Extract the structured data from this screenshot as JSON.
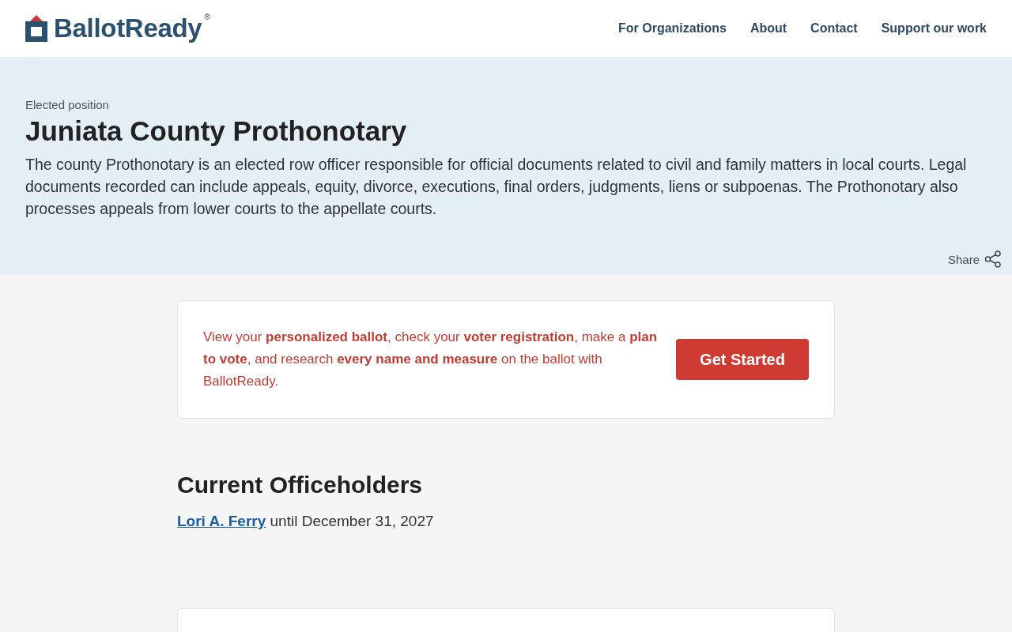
{
  "header": {
    "logo": {
      "name": "BallotReady",
      "mark": "®"
    },
    "nav": [
      "For Organizations",
      "About",
      "Contact",
      "Support our work"
    ]
  },
  "hero": {
    "eyebrow": "Elected position",
    "title": "Juniata County Prothonotary",
    "description": "The county Prothonotary is an elected row officer responsible for official documents related to civil and family matters in local courts. Legal documents recorded can include appeals, equity, divorce, executions, final orders, judgments, liens or subpoenas. The Prothonotary also processes appeals from lower courts to the appellate courts.",
    "share": "Share"
  },
  "cta_card": {
    "text": "View your **personalized ballot**, check your **voter registration**, make a **plan to vote**, and research **every name and measure** on the ballot with BallotReady.",
    "button": "Get Started"
  },
  "officeholders": {
    "heading": "Current Officeholders",
    "items": [
      {
        "name": "Lori A. Ferry",
        "term": "until December 31, 2027"
      }
    ]
  }
}
